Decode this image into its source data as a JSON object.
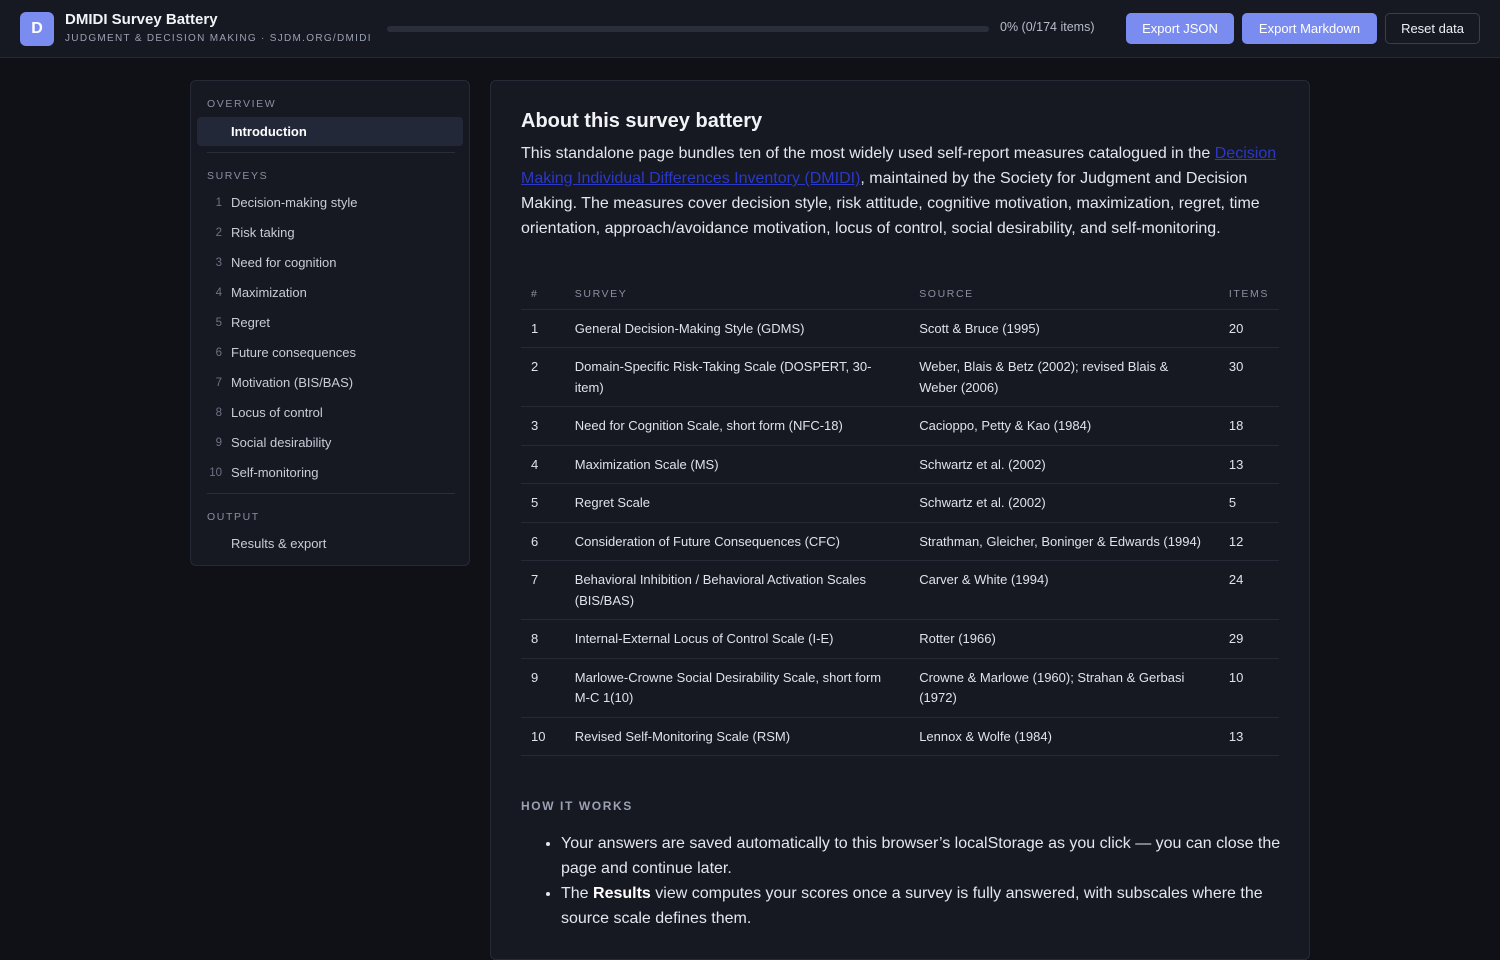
{
  "header": {
    "logo_letter": "D",
    "title": "DMIDI Survey Battery",
    "subtitle": "JUDGMENT & DECISION MAKING · SJDM.ORG/DMIDI",
    "progress_fraction": 0,
    "progress_text": "0% (0/174 items)",
    "export_json_label": "Export JSON",
    "export_markdown_label": "Export Markdown",
    "reset_label": "Reset data"
  },
  "sidebar": {
    "overview_heading": "OVERVIEW",
    "intro_label": "Introduction",
    "surveys_heading": "SURVEYS",
    "surveys": [
      {
        "num": "1",
        "label": "Decision-making style"
      },
      {
        "num": "2",
        "label": "Risk taking"
      },
      {
        "num": "3",
        "label": "Need for cognition"
      },
      {
        "num": "4",
        "label": "Maximization"
      },
      {
        "num": "5",
        "label": "Regret"
      },
      {
        "num": "6",
        "label": "Future consequences"
      },
      {
        "num": "7",
        "label": "Motivation (BIS/BAS)"
      },
      {
        "num": "8",
        "label": "Locus of control"
      },
      {
        "num": "9",
        "label": "Social desirability"
      },
      {
        "num": "10",
        "label": "Self-monitoring"
      }
    ],
    "output_heading": "OUTPUT",
    "results_label": "Results & export"
  },
  "main": {
    "title": "About this survey battery",
    "intro_before": "This standalone page bundles ten of the most widely used self-report measures catalogued in the ",
    "intro_link": "Decision Making Individual Differences Inventory (DMIDI)",
    "intro_after": ", maintained by the Society for Judgment and Decision Making. The measures cover decision style, risk attitude, cognitive motivation, maximization, regret, time orientation, approach/avoidance motivation, locus of control, social desirability, and self-monitoring.",
    "table": {
      "headers": [
        "#",
        "SURVEY",
        "SOURCE",
        "ITEMS"
      ],
      "rows": [
        [
          "1",
          "General Decision-Making Style (GDMS)",
          "Scott & Bruce (1995)",
          "20"
        ],
        [
          "2",
          "Domain-Specific Risk-Taking Scale (DOSPERT, 30-item)",
          "Weber, Blais & Betz (2002); revised Blais & Weber (2006)",
          "30"
        ],
        [
          "3",
          "Need for Cognition Scale, short form (NFC-18)",
          "Cacioppo, Petty & Kao (1984)",
          "18"
        ],
        [
          "4",
          "Maximization Scale (MS)",
          "Schwartz et al. (2002)",
          "13"
        ],
        [
          "5",
          "Regret Scale",
          "Schwartz et al. (2002)",
          "5"
        ],
        [
          "6",
          "Consideration of Future Consequences (CFC)",
          "Strathman, Gleicher, Boninger & Edwards (1994)",
          "12"
        ],
        [
          "7",
          "Behavioral Inhibition / Behavioral Activation Scales (BIS/BAS)",
          "Carver & White (1994)",
          "24"
        ],
        [
          "8",
          "Internal-External Locus of Control Scale (I-E)",
          "Rotter (1966)",
          "29"
        ],
        [
          "9",
          "Marlowe-Crowne Social Desirability Scale, short form M-C 1(10)",
          "Crowne & Marlowe (1960); Strahan & Gerbasi (1972)",
          "10"
        ],
        [
          "10",
          "Revised Self-Monitoring Scale (RSM)",
          "Lennox & Wolfe (1984)",
          "13"
        ]
      ]
    },
    "how_heading": "HOW IT WORKS",
    "how_items": [
      {
        "text": "Your answers are saved automatically to this browser’s localStorage as you click — you can close the page and continue later."
      },
      {
        "before": "The ",
        "bold": "Results",
        "after": " view computes your scores once a survey is fully answered, with subscales where the source scale defines them."
      }
    ]
  },
  "colors": {
    "background": "#0f1117",
    "panel": "#161922",
    "accent": "#7b8cf0",
    "link": "#2a38c9"
  }
}
